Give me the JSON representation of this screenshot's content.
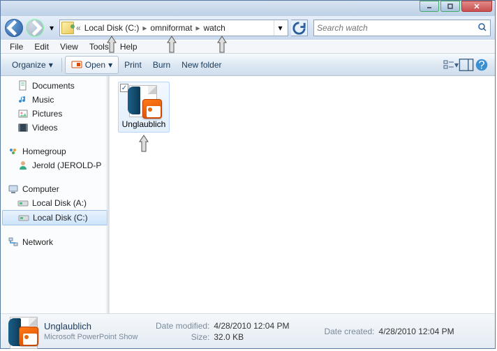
{
  "titlebar": {
    "left_blur": "",
    "center_blur": ""
  },
  "nav": {
    "overflow": "«",
    "crumbs": [
      "Local Disk (C:)",
      "omniformat",
      "watch"
    ]
  },
  "search": {
    "placeholder": "Search watch"
  },
  "menu": [
    "File",
    "Edit",
    "View",
    "Tools",
    "Help"
  ],
  "toolbar": {
    "organize": "Organize",
    "open": "Open",
    "print": "Print",
    "burn": "Burn",
    "newfolder": "New folder"
  },
  "sidebar": {
    "libraries": [
      {
        "label": "Documents",
        "icon": "doc"
      },
      {
        "label": "Music",
        "icon": "music"
      },
      {
        "label": "Pictures",
        "icon": "pic"
      },
      {
        "label": "Videos",
        "icon": "vid"
      }
    ],
    "homegroup_label": "Homegroup",
    "homegroup_items": [
      {
        "label": "Jerold (JEROLD-P"
      }
    ],
    "computer_label": "Computer",
    "computer_items": [
      {
        "label": "Local Disk (A:)",
        "sel": false
      },
      {
        "label": "Local Disk (C:)",
        "sel": true
      }
    ],
    "network_label": "Network"
  },
  "file": {
    "name": "Unglaublich",
    "checked": true
  },
  "details": {
    "title": "Unglaublich",
    "type": "Microsoft PowerPoint Show",
    "modified_label": "Date modified:",
    "modified": "4/28/2010 12:04 PM",
    "size_label": "Size:",
    "size": "32.0 KB",
    "created_label": "Date created:",
    "created": "4/28/2010 12:04 PM"
  }
}
